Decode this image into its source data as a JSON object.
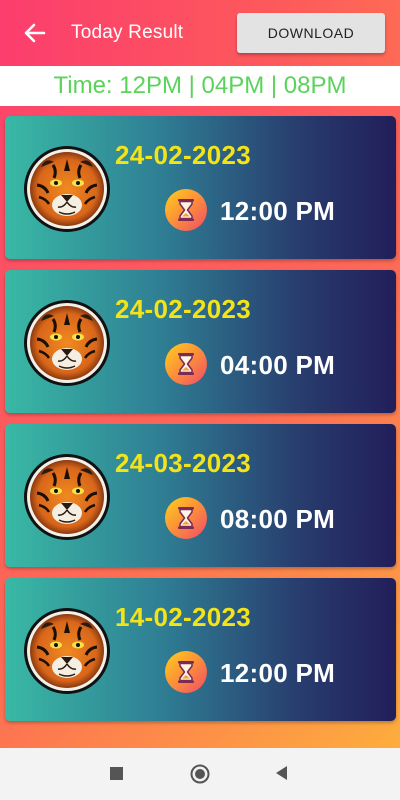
{
  "header": {
    "title": "Today Result",
    "download_label": "DOWNLOAD"
  },
  "timebar": {
    "text": "Time: 12PM | 04PM | 08PM"
  },
  "results": [
    {
      "date": "24-02-2023",
      "time": "12:00 PM"
    },
    {
      "date": "24-02-2023",
      "time": "04:00 PM"
    },
    {
      "date": "24-03-2023",
      "time": "08:00 PM"
    },
    {
      "date": "14-02-2023",
      "time": "12:00 PM"
    }
  ],
  "icons": {
    "back": "arrow-left-icon",
    "logo": "tiger-logo",
    "clock": "hourglass-icon",
    "nav_recent": "square-icon",
    "nav_home": "circle-icon",
    "nav_back": "triangle-back-icon"
  },
  "colors": {
    "header_gradient": [
      "#fc3d6e",
      "#fe6a55"
    ],
    "time_text": "#5bd35b",
    "date_text": "#f3e319",
    "card_gradient": [
      "#39b9a5",
      "#221e5a"
    ]
  }
}
